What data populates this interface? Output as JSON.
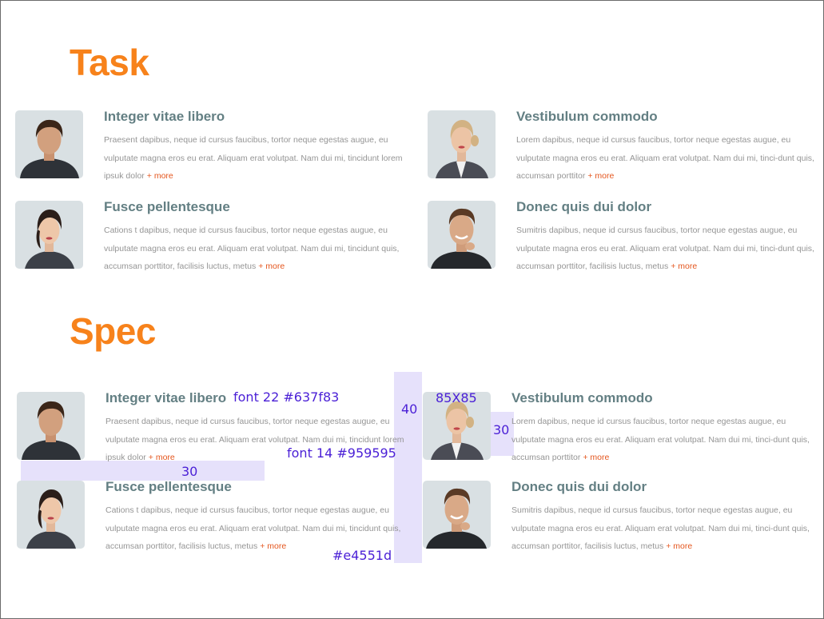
{
  "sections": {
    "task_title": "Task",
    "spec_title": "Spec"
  },
  "cards": [
    {
      "title": "Integer vitae libero",
      "body": "Praesent dapibus, neque id cursus faucibus, tortor neque egestas augue, eu vulputate magna eros eu erat. Aliquam erat volutpat. Nam dui mi, tincidunt lorem ipsuk dolor",
      "more": "+ more",
      "photo": "man-portrait-dark-hair"
    },
    {
      "title": "Vestibulum commodo",
      "body": "Lorem dapibus, neque id cursus faucibus, tortor neque egestas augue, eu vulputate magna eros eu erat. Aliquam erat volutpat. Nam dui mi, tinci-dunt quis, accumsan porttitor",
      "more": "+ more",
      "photo": "woman-portrait-blonde-suit"
    },
    {
      "title": "Fusce pellentesque",
      "body": "Cations t dapibus, neque id cursus faucibus, tortor neque egestas augue, eu vulputate magna eros eu erat. Aliquam erat volutpat. Nam dui mi, tincidunt quis, accumsan porttitor, facilisis luctus, metus",
      "more": "+ more",
      "photo": "woman-portrait-dark-hair"
    },
    {
      "title": "Donec quis dui dolor",
      "body": "Sumitris dapibus, neque id cursus faucibus, tortor neque egestas augue, eu vulputate magna eros eu erat. Aliquam erat volutpat. Nam dui mi, tinci-dunt quis, accumsan porttitor, facilisis luctus, metus",
      "more": "+ more",
      "photo": "man-portrait-smiling"
    }
  ],
  "spec": {
    "title_font": "font 22 #637f83",
    "body_font": "font 14 #959595",
    "link_color": "#e4551d",
    "image_size": "85X85",
    "column_gap": "40",
    "row_gap": "30",
    "image_text_gap": "30"
  },
  "colors": {
    "section_title": "#f7821b",
    "card_title": "#637f83",
    "card_body": "#959595",
    "more_link": "#e4551d",
    "photo_bg": "#d9e0e3",
    "spec_annotation": "#4a1fd6"
  }
}
